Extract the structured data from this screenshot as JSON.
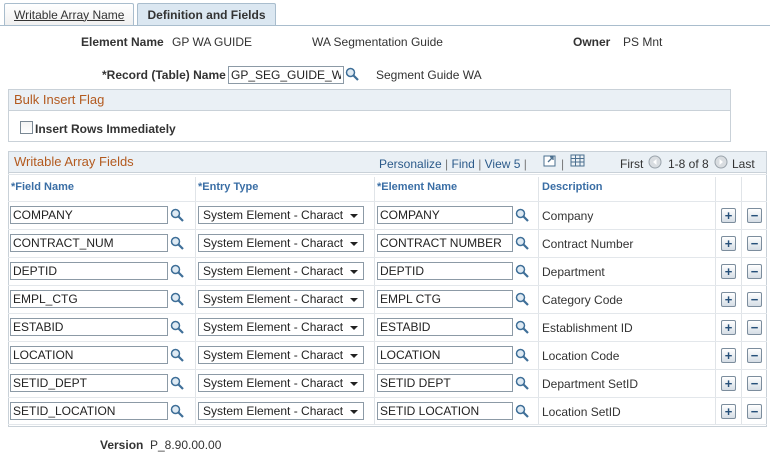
{
  "tabs": [
    {
      "label": "Writable Array Name",
      "active": false
    },
    {
      "label": "Definition and Fields",
      "active": true
    }
  ],
  "header": {
    "element_name_label": "Element Name",
    "element_name_value": "GP WA GUIDE",
    "element_desc": "WA Segmentation Guide",
    "owner_label": "Owner",
    "owner_value": "PS Mnt",
    "record_label": "*Record (Table) Name",
    "record_value": "GP_SEG_GUIDE_WA",
    "record_desc": "Segment Guide WA"
  },
  "bulk_insert": {
    "title": "Bulk Insert Flag",
    "checkbox_label": "Insert Rows Immediately",
    "checked": false
  },
  "grid": {
    "title": "Writable Array Fields",
    "nav": {
      "personalize": "Personalize",
      "find": "Find",
      "view": "View 5",
      "first": "First",
      "range": "1-8 of 8",
      "last": "Last"
    },
    "columns": [
      "*Field Name",
      "*Entry Type",
      "*Element Name",
      "Description"
    ],
    "rows": [
      {
        "field": "COMPANY",
        "entry": "System Element - Charact",
        "element": "COMPANY",
        "desc": "Company"
      },
      {
        "field": "CONTRACT_NUM",
        "entry": "System Element - Charact",
        "element": "CONTRACT NUMBER",
        "desc": "Contract Number"
      },
      {
        "field": "DEPTID",
        "entry": "System Element - Charact",
        "element": "DEPTID",
        "desc": "Department"
      },
      {
        "field": "EMPL_CTG",
        "entry": "System Element - Charact",
        "element": "EMPL CTG",
        "desc": "Category Code"
      },
      {
        "field": "ESTABID",
        "entry": "System Element - Charact",
        "element": "ESTABID",
        "desc": "Establishment ID"
      },
      {
        "field": "LOCATION",
        "entry": "System Element - Charact",
        "element": "LOCATION",
        "desc": "Location Code"
      },
      {
        "field": "SETID_DEPT",
        "entry": "System Element - Charact",
        "element": "SETID DEPT",
        "desc": "Department SetID"
      },
      {
        "field": "SETID_LOCATION",
        "entry": "System Element - Charact",
        "element": "SETID LOCATION",
        "desc": "Location SetID"
      }
    ],
    "add_symbol": "+",
    "delete_symbol": "−"
  },
  "footer": {
    "version_label": "Version",
    "version_value": "P_8.90.00.00"
  },
  "colors": {
    "accent_link": "#2b5a8a",
    "group_title": "#b35a1f",
    "group_bg": "#eaf0f5",
    "column_header": "#3a6ea5"
  },
  "icons": [
    "lookup-icon",
    "zoom-grid-icon",
    "download-grid-icon",
    "previous-arrow-icon",
    "add-row-icon",
    "delete-row-icon"
  ]
}
